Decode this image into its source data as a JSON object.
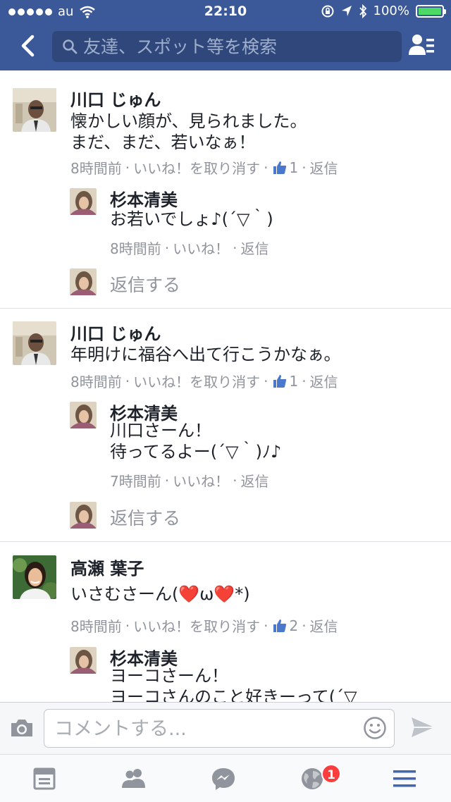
{
  "status_bar": {
    "carrier": "au",
    "time": "22:10",
    "battery": "100%"
  },
  "header": {
    "search_placeholder": "友達、スポット等を検索",
    "icons": [
      "back-chevron-icon",
      "search-icon",
      "friend-requests-icon"
    ]
  },
  "threads": [
    {
      "author": "川口 じゅん",
      "lines": [
        "懐かしい顔が、見られました。",
        "まだ、まだ、若いなぁ！"
      ],
      "time": "8時間前",
      "like_action": "いいね！を取り消す",
      "like_count": "1",
      "reply_action": "返信",
      "reply": {
        "author": "杉本清美",
        "lines": [
          "お若いでしょ♪(´▽｀)"
        ],
        "time": "8時間前",
        "like_action": "いいね！",
        "reply_action": "返信"
      },
      "reply_prompt": "返信する"
    },
    {
      "author": "川口 じゅん",
      "lines": [
        "年明けに福谷へ出て行こうかなぁ。"
      ],
      "time": "8時間前",
      "like_action": "いいね！を取り消す",
      "like_count": "1",
      "reply_action": "返信",
      "reply": {
        "author": "杉本清美",
        "lines": [
          "川口さーん！",
          "待ってるよー(´▽｀)ﾉ♪"
        ],
        "time": "7時間前",
        "like_action": "いいね！",
        "reply_action": "返信"
      },
      "reply_prompt": "返信する"
    },
    {
      "author": "高瀬 葉子",
      "lines": [
        "いさむさーん(❤️ω❤️*)"
      ],
      "time": "8時間前",
      "like_action": "いいね！を取り消す",
      "like_count": "2",
      "reply_action": "返信",
      "reply": {
        "author": "杉本清美",
        "lines": [
          "ヨーコさーん！",
          "ヨーコさんのこと好きーって(´▽"
        ]
      }
    }
  ],
  "composer": {
    "placeholder": "コメントする...",
    "icons": [
      "camera-icon",
      "sticker-smiley-icon",
      "send-icon"
    ]
  },
  "tabbar": {
    "tabs": [
      "news-feed-icon",
      "friends-icon",
      "messenger-icon",
      "notifications-globe-icon",
      "menu-icon"
    ],
    "notification_badge": "1",
    "active_tab": "menu-icon",
    "accent_color": "#4267b2"
  }
}
